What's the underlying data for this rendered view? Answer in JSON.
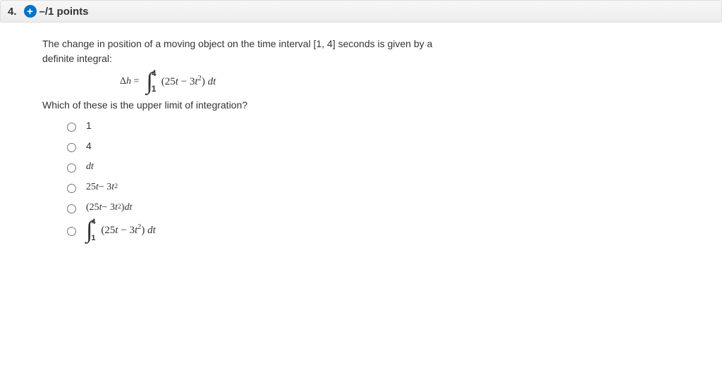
{
  "question": {
    "number": "4.",
    "points": "–/1 points"
  },
  "prompt_line1": "The change in position of a moving object on the time interval [1, 4] seconds is given by a",
  "prompt_line2": "definite integral:",
  "equation": {
    "lhs": "Δh =",
    "upper": "4",
    "lower": "1",
    "integrand_pre": "(25",
    "integrand_t1": "t",
    "integrand_mid": " − 3",
    "integrand_t2": "t",
    "integrand_sup": "2",
    "integrand_post": ") ",
    "dt_d": "d",
    "dt_t": "t"
  },
  "sub_question": "Which of these is the upper limit of integration?",
  "options": {
    "o1": "1",
    "o2": "4",
    "o3_d": "d",
    "o3_t": "t",
    "o4_a": "25",
    "o4_t1": "t",
    "o4_b": " − 3",
    "o4_t2": "t",
    "o4_sup": "2",
    "o5_a": "(25",
    "o5_t1": "t",
    "o5_b": " − 3",
    "o5_t2": "t",
    "o5_sup": "2",
    "o5_c": ") ",
    "o5_d": "d",
    "o5_t3": "t",
    "o6_upper": "4",
    "o6_lower": "1",
    "o6_a": "(25",
    "o6_t1": "t",
    "o6_b": " − 3",
    "o6_t2": "t",
    "o6_sup": "2",
    "o6_c": ") ",
    "o6_d": "d",
    "o6_t3": "t"
  }
}
